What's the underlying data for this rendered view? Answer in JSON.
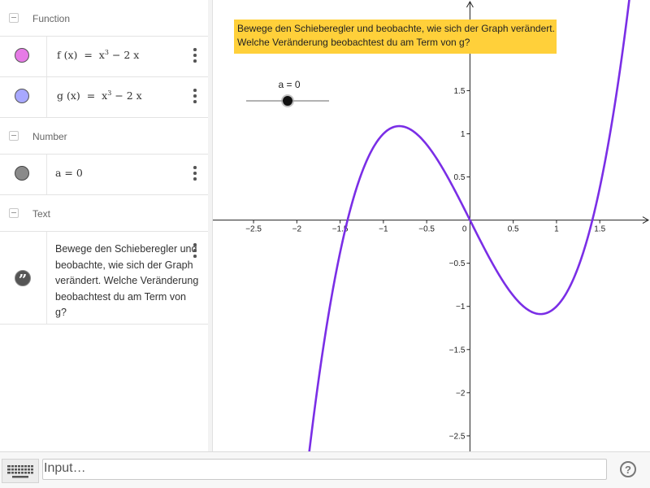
{
  "algebra": {
    "sections": [
      {
        "label": "Function"
      },
      {
        "label": "Number"
      },
      {
        "label": "Text"
      }
    ],
    "function_f": {
      "name": "f (x)",
      "eq": "=",
      "expr_base": "x",
      "expr_exp": "3",
      "expr_rest": "− 2 x",
      "color": "#e67be6"
    },
    "function_g": {
      "name": "g (x)",
      "eq": "=",
      "expr_base": "x",
      "expr_exp": "3",
      "expr_rest": "− 2 x",
      "color": "#a8a8ff"
    },
    "number_a": {
      "text": "a = 0",
      "color": "#8a8a8a"
    },
    "text_obj": {
      "lines": [
        "Bewege den Schieberegler und",
        "beobachte, wie sich der Graph",
        "verändert. Welche Veränderung",
        "beobachtest du am Term von",
        "g?"
      ]
    }
  },
  "graphics": {
    "info_text": {
      "line1": "Bewege den Schieberegler und beobachte, wie sich der Graph verändert.",
      "line2": "Welche Veränderung beobachtest du am Term von g?"
    },
    "slider": {
      "label": "a = 0",
      "value": 0,
      "min": -5,
      "max": 5
    },
    "curve_color": "#7a2ee6"
  },
  "chart_data": {
    "type": "line",
    "function": "x^3 - 2x",
    "xlim": [
      -2.97,
      2.08
    ],
    "ylim": [
      -2.68,
      2.55
    ],
    "x_ticks": [
      "−2.5",
      "−2",
      "−1.5",
      "−1",
      "−0.5",
      "0",
      "0.5",
      "1",
      "1.5"
    ],
    "x_tick_values": [
      -2.5,
      -2,
      -1.5,
      -1,
      -0.5,
      0,
      0.5,
      1,
      1.5
    ],
    "y_ticks": [
      "1.5",
      "1",
      "0.5",
      "−0.5",
      "−1",
      "−1.5",
      "−2",
      "−2.5"
    ],
    "y_tick_values": [
      1.5,
      1,
      0.5,
      -0.5,
      -1,
      -1.5,
      -2,
      -2.5
    ],
    "grid": false
  },
  "input_bar": {
    "placeholder": "Input…",
    "help_label": "?"
  }
}
